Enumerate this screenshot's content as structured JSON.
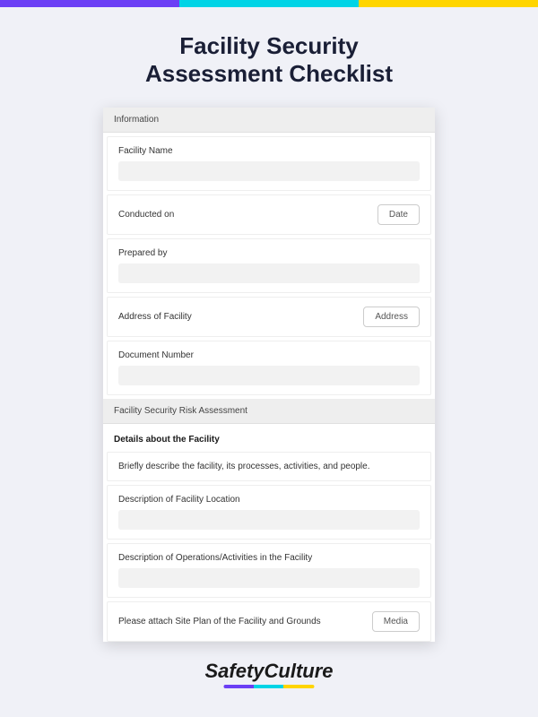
{
  "colors": {
    "purple": "#6b3ff5",
    "cyan": "#00d4e6",
    "yellow": "#ffd500"
  },
  "title": {
    "line1": "Facility Security",
    "line2": "Assessment Checklist"
  },
  "sections": {
    "information": {
      "header": "Information",
      "fields": {
        "facility_name": {
          "label": "Facility Name"
        },
        "conducted_on": {
          "label": "Conducted on",
          "button": "Date"
        },
        "prepared_by": {
          "label": "Prepared by"
        },
        "address": {
          "label": "Address of Facility",
          "button": "Address"
        },
        "document_number": {
          "label": "Document Number"
        }
      }
    },
    "risk_assessment": {
      "header": "Facility Security Risk Assessment",
      "subheading": "Details about the Facility",
      "fields": {
        "describe": {
          "label": "Briefly describe the facility, its processes, activities, and people."
        },
        "location": {
          "label": "Description of Facility Location"
        },
        "operations": {
          "label": "Description of Operations/Activities in the Facility"
        },
        "site_plan": {
          "label": "Please attach Site Plan of the Facility and Grounds",
          "button": "Media"
        }
      }
    }
  },
  "footer": {
    "brand": "SafetyCulture"
  }
}
